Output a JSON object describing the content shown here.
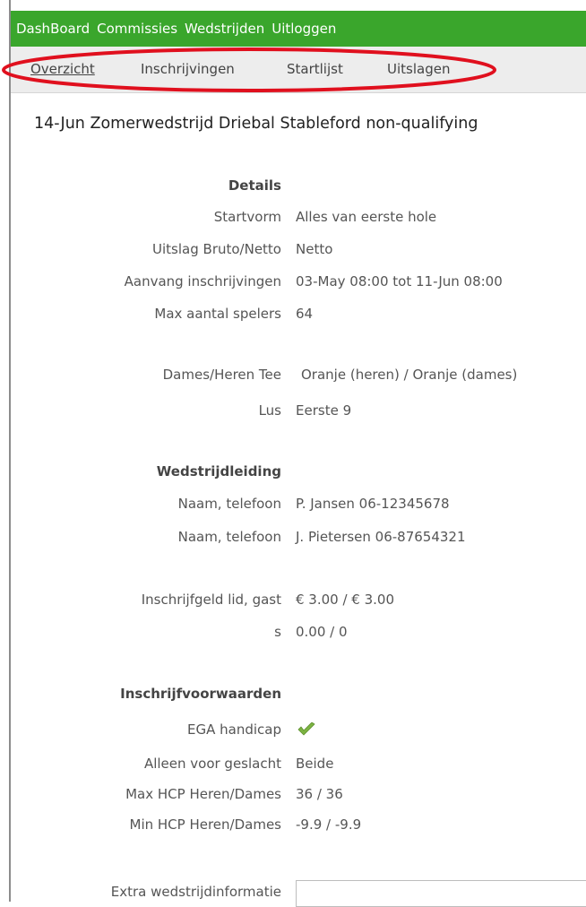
{
  "topnav": {
    "items": [
      "DashBoard",
      "Commissies",
      "Wedstrijden",
      "Uitloggen"
    ],
    "color": "#3aa62c"
  },
  "subnav": {
    "items": [
      "Overzicht",
      "Inschrijvingen",
      "Startlijst",
      "Uitslagen"
    ],
    "active": "Overzicht",
    "highlight_color": "#e0101e"
  },
  "page_title": "14-Jun Zomerwedstrijd Driebal Stableford non-qualifying",
  "details": {
    "heading": "Details",
    "startvorm_label": "Startvorm",
    "startvorm_value": "Alles van eerste hole",
    "uitslag_label": "Uitslag Bruto/Netto",
    "uitslag_value": "Netto",
    "aanvang_label": "Aanvang inschrijvingen",
    "aanvang_value": "03-May 08:00 tot 11-Jun 08:00",
    "max_label": "Max aantal spelers",
    "max_value": "64",
    "tee_label": "Dames/Heren Tee",
    "tee_value": "Oranje (heren) / Oranje (dames)",
    "lus_label": "Lus",
    "lus_value": "Eerste 9"
  },
  "wedstrijdleiding": {
    "heading": "Wedstrijdleiding",
    "rows": [
      {
        "label": "Naam, telefoon",
        "value": "P. Jansen 06-12345678"
      },
      {
        "label": "Naam, telefoon",
        "value": "J. Pietersen 06-87654321"
      }
    ]
  },
  "fees": {
    "label": "Inschrijfgeld lid, gast",
    "value": "€ 3.00 / € 3.00",
    "s_label": "s",
    "s_value": "0.00 / 0"
  },
  "voorwaarden": {
    "heading": "Inschrijfvoorwaarden",
    "ega_label": "EGA handicap",
    "ega_icon": "checkmark-icon",
    "geslacht_label": "Alleen voor geslacht",
    "geslacht_value": "Beide",
    "maxhcp_label": "Max HCP Heren/Dames",
    "maxhcp_value": "36 / 36",
    "minhcp_label": "Min HCP Heren/Dames",
    "minhcp_value": "-9.9 / -9.9"
  },
  "extra": {
    "label": "Extra wedstrijdinformatie",
    "value": ""
  }
}
